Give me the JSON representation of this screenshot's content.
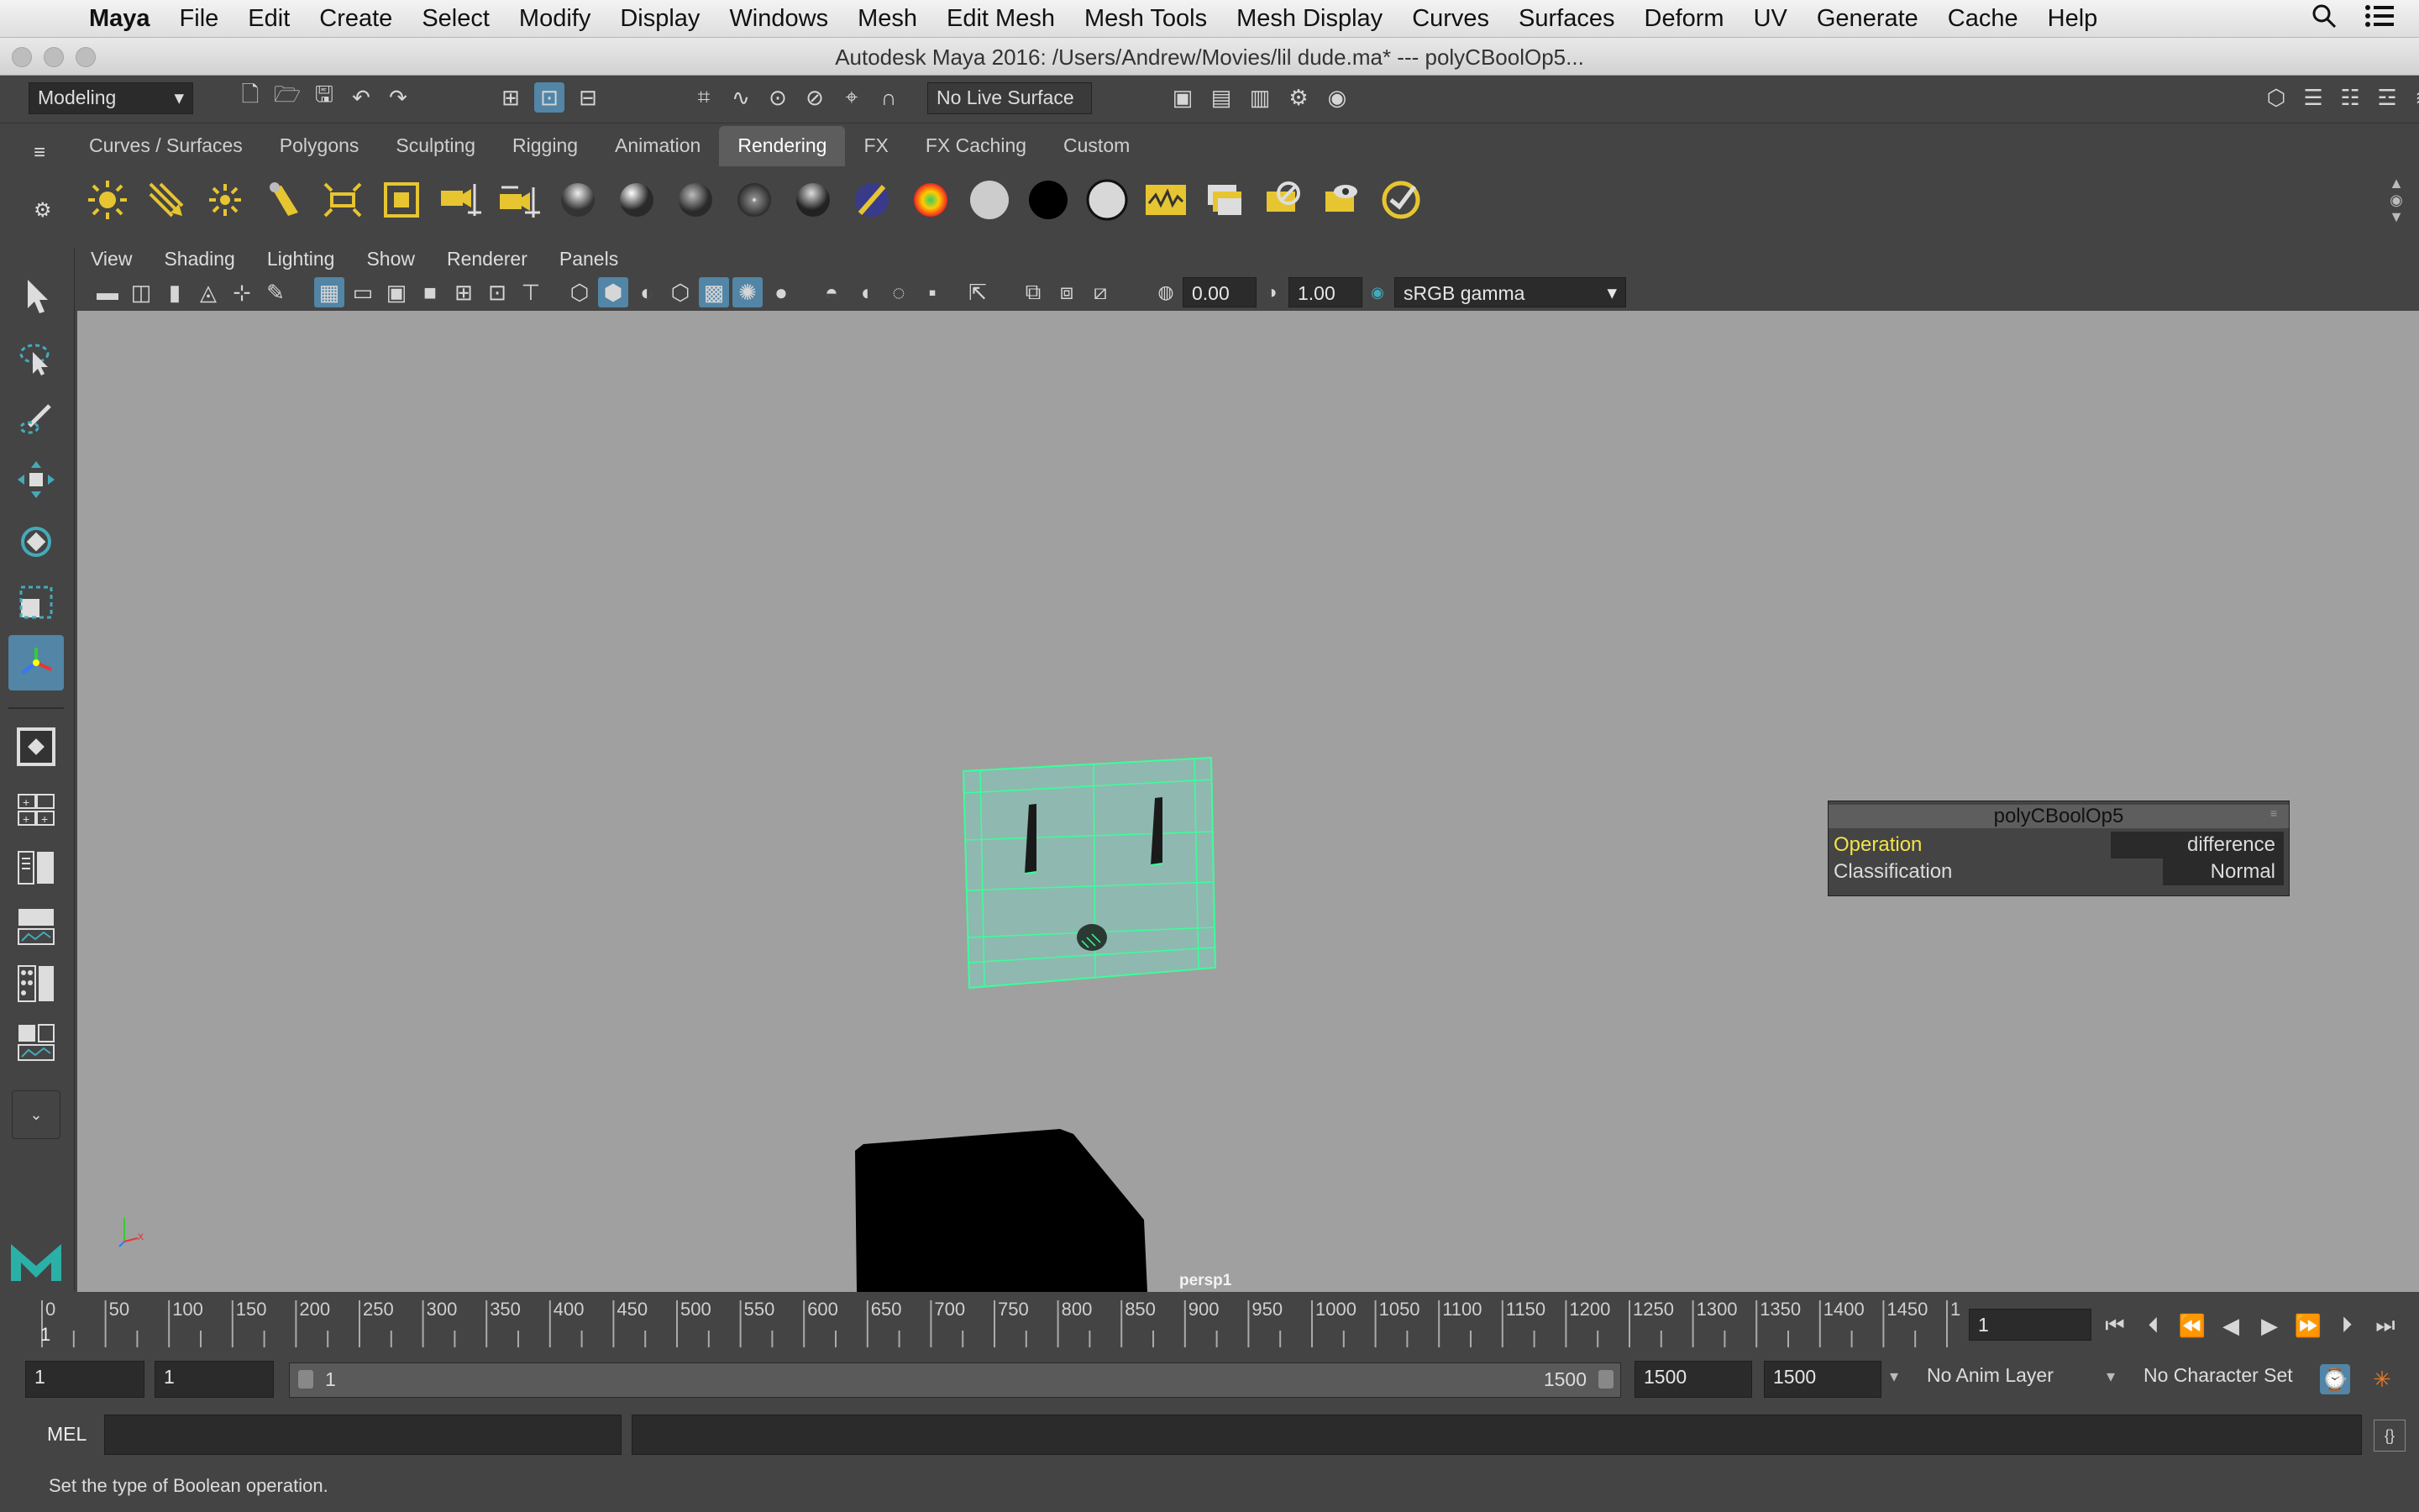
{
  "menubar": {
    "app": "Maya",
    "items": [
      "File",
      "Edit",
      "Create",
      "Select",
      "Modify",
      "Display",
      "Windows",
      "Mesh",
      "Edit Mesh",
      "Mesh Tools",
      "Mesh Display",
      "Curves",
      "Surfaces",
      "Deform",
      "UV",
      "Generate",
      "Cache",
      "Help"
    ]
  },
  "window": {
    "title": "Autodesk Maya 2016: /Users/Andrew/Movies/lil dude.ma*    ---    polyCBoolOp5..."
  },
  "statusline": {
    "mode": "Modeling",
    "live_surface": "No Live Surface"
  },
  "shelf": {
    "tabs": [
      "Curves / Surfaces",
      "Polygons",
      "Sculpting",
      "Rigging",
      "Animation",
      "Rendering",
      "FX",
      "FX Caching",
      "Custom"
    ],
    "active_tab": "Rendering"
  },
  "panel": {
    "menus": [
      "View",
      "Shading",
      "Lighting",
      "Show",
      "Renderer",
      "Panels"
    ],
    "exposure": "0.00",
    "gamma": "1.00",
    "color_space": "sRGB gamma",
    "camera_label": "persp1"
  },
  "bool_box": {
    "title": "polyCBoolOp5",
    "rows": [
      {
        "label": "Operation",
        "value": "difference"
      },
      {
        "label": "Classification",
        "value": "Normal"
      }
    ]
  },
  "timeline": {
    "ticks": [
      "0",
      "50",
      "100",
      "150",
      "200",
      "250",
      "300",
      "350",
      "400",
      "450",
      "500",
      "550",
      "600",
      "650",
      "700",
      "750",
      "800",
      "850",
      "900",
      "950",
      "1000",
      "1050",
      "1100",
      "1150",
      "1200",
      "1250",
      "1300",
      "1350",
      "1400",
      "1450",
      "1"
    ],
    "current_frame_marker": "1",
    "current_frame": "1"
  },
  "range": {
    "start": "1",
    "anim_start": "1",
    "slider_start": "1",
    "slider_end": "1500",
    "anim_end": "1500",
    "end": "1500",
    "anim_layer": "No Anim Layer",
    "char_set": "No Character Set"
  },
  "command": {
    "language": "MEL"
  },
  "help": {
    "text": "Set the type of Boolean operation."
  }
}
